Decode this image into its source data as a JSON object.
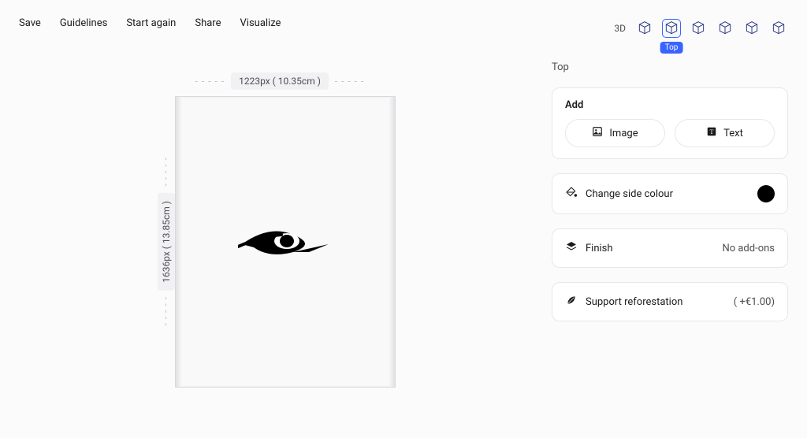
{
  "menu": {
    "save": "Save",
    "guidelines": "Guidelines",
    "start_again": "Start again",
    "share": "Share",
    "visualize": "Visualize"
  },
  "canvas": {
    "width_label": "1223px ( 10.35cm )",
    "height_label": "1636px ( 13.85cm )",
    "dash": "- - - - -"
  },
  "views": {
    "label": "3D",
    "selected_index": 1,
    "selected_tag": "Top",
    "section_title": "Top"
  },
  "add": {
    "title": "Add",
    "image": "Image",
    "text": "Text"
  },
  "side_colour": {
    "label": "Change side colour",
    "swatch": "#000000"
  },
  "finish": {
    "label": "Finish",
    "value": "No add-ons"
  },
  "reforestation": {
    "label": "Support reforestation",
    "value": "( +€1.00)"
  }
}
